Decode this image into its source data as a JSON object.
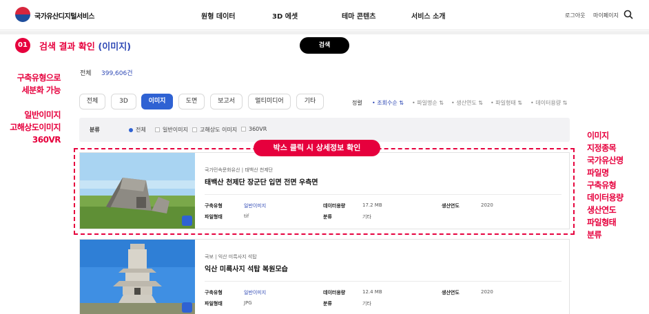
{
  "header": {
    "logo_text": "국가유산디지털서비스",
    "nav": [
      "원형 데이터",
      "3D 에셋",
      "테마 콘텐츠",
      "서비스 소개"
    ],
    "login": "로그아웃",
    "mypage": "마이페이지"
  },
  "step": {
    "number": "01",
    "title": "검색 결과 확인",
    "title_highlight": "(이미지)",
    "search_button": "검색"
  },
  "annotations": {
    "left1_line1": "구축유형으로",
    "left1_line2": "세분화 가능",
    "left2_line1": "일반이미지",
    "left2_line2": "고해상도이미지",
    "left2_line3": "360VR",
    "right": [
      "이미지",
      "지정종목",
      "국가유산명",
      "파일명",
      "구축유형",
      "데이터용량",
      "생산연도",
      "파일형태",
      "분류"
    ],
    "callout": "박스 클릭 시 상세정보 확인"
  },
  "totals": {
    "label": "전체",
    "value": "399,606건"
  },
  "tabs": [
    "전체",
    "3D",
    "이미지",
    "도면",
    "보고서",
    "멀티미디어",
    "기타"
  ],
  "sort": {
    "label": "정렬",
    "items": [
      "조회수순",
      "파일명순",
      "생산연도",
      "파일형태",
      "데이터용량"
    ]
  },
  "filter": {
    "label": "분류",
    "options": [
      "전체",
      "일반이미지",
      "고해상도 이미지",
      "360VR"
    ]
  },
  "field_labels": {
    "build_type": "구축유형",
    "file_type": "파일형태",
    "data_size": "데이터용량",
    "category": "분류",
    "year": "생산연도"
  },
  "results": [
    {
      "breadcrumb_a": "국가민속문화유산",
      "breadcrumb_b": "태백산 천제단",
      "title": "태백산 천제단 장군단 입면 전면 우측면",
      "build_type": "일반이미지",
      "file_type": "tif",
      "data_size": "17.2 MB",
      "category": "기타",
      "year": "2020"
    },
    {
      "breadcrumb_a": "국보",
      "breadcrumb_b": "익산 미륵사지 석탑",
      "title": "익산 미륵사지 석탑 복원모습",
      "build_type": "일반이미지",
      "file_type": "JPG",
      "data_size": "12.4 MB",
      "category": "기타",
      "year": "2020"
    }
  ]
}
